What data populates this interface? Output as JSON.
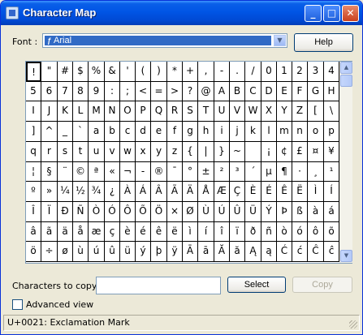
{
  "window": {
    "title": "Character Map",
    "title_buttons": [
      "_",
      "□",
      "✕"
    ]
  },
  "font": {
    "label": "Font :",
    "selected": "Arial",
    "icon": "font-type-icon"
  },
  "help_label": "Help",
  "grid_rows": [
    [
      "!",
      "\"",
      "#",
      "$",
      "%",
      "&",
      "'",
      "(",
      ")",
      "*",
      "+",
      ",",
      "-",
      ".",
      "/",
      "0",
      "1",
      "2",
      "3",
      "4"
    ],
    [
      "5",
      "6",
      "7",
      "8",
      "9",
      ":",
      ";",
      "<",
      "=",
      ">",
      "?",
      "@",
      "A",
      "B",
      "C",
      "D",
      "E",
      "F",
      "G",
      "H"
    ],
    [
      "I",
      "J",
      "K",
      "L",
      "M",
      "N",
      "O",
      "P",
      "Q",
      "R",
      "S",
      "T",
      "U",
      "V",
      "W",
      "X",
      "Y",
      "Z",
      "[",
      "\\"
    ],
    [
      "]",
      "^",
      "_",
      "`",
      "a",
      "b",
      "c",
      "d",
      "e",
      "f",
      "g",
      "h",
      "i",
      "j",
      "k",
      "l",
      "m",
      "n",
      "o",
      "p"
    ],
    [
      "q",
      "r",
      "s",
      "t",
      "u",
      "v",
      "w",
      "x",
      "y",
      "z",
      "{",
      "|",
      "}",
      "~",
      " ",
      "¡",
      "¢",
      "£",
      "¤",
      "¥"
    ],
    [
      "¦",
      "§",
      "¨",
      "©",
      "ª",
      "«",
      "¬",
      "-",
      "®",
      "¯",
      "°",
      "±",
      "²",
      "³",
      "´",
      "µ",
      "¶",
      "·",
      "¸",
      "¹"
    ],
    [
      "º",
      "»",
      "¼",
      "½",
      "¾",
      "¿",
      "À",
      "Á",
      "Â",
      "Ã",
      "Ä",
      "Å",
      "Æ",
      "Ç",
      "È",
      "É",
      "Ê",
      "Ë",
      "Ì",
      "Í"
    ],
    [
      "Î",
      "Ï",
      "Ð",
      "Ñ",
      "Ò",
      "Ó",
      "Ô",
      "Õ",
      "Ö",
      "×",
      "Ø",
      "Ù",
      "Ú",
      "Û",
      "Ü",
      "Ý",
      "Þ",
      "ß",
      "à",
      "á"
    ],
    [
      "â",
      "ã",
      "ä",
      "å",
      "æ",
      "ç",
      "è",
      "é",
      "ê",
      "ë",
      "ì",
      "í",
      "î",
      "ï",
      "ð",
      "ñ",
      "ò",
      "ó",
      "ô",
      "õ"
    ],
    [
      "ö",
      "÷",
      "ø",
      "ù",
      "ú",
      "û",
      "ü",
      "ý",
      "þ",
      "ÿ",
      "Ā",
      "ā",
      "Ă",
      "ă",
      "Ą",
      "ą",
      "Ć",
      "ć",
      "Ĉ",
      "ĉ"
    ]
  ],
  "selected_char": "!",
  "copy": {
    "label": "Characters to copy :",
    "value": "",
    "select_label": "Select",
    "copy_label": "Copy"
  },
  "advanced_view": {
    "label": "Advanced view",
    "checked": false
  },
  "status": "U+0021: Exclamation Mark",
  "colors": {
    "titlebar": "#0055E5",
    "face": "#ECE9D8",
    "selection": "#316AC5"
  }
}
